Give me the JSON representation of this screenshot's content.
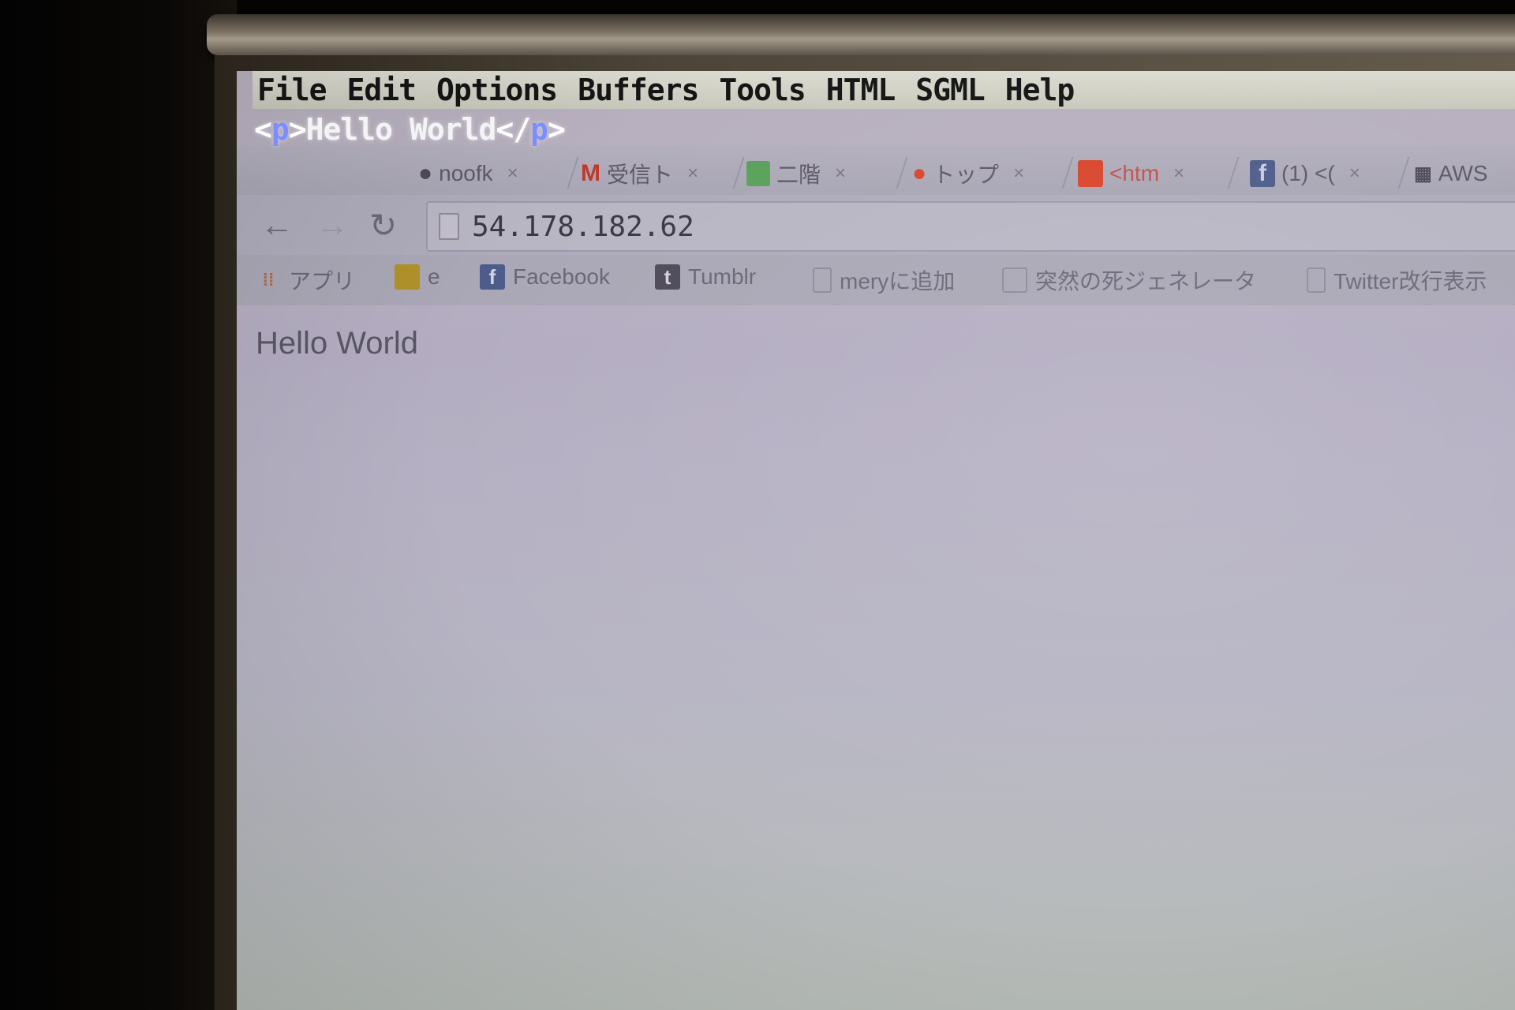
{
  "emacs": {
    "menu": [
      "File",
      "Edit",
      "Options",
      "Buffers",
      "Tools",
      "HTML",
      "SGML",
      "Help"
    ],
    "buffer_line": {
      "open_lt": "<",
      "open_tag": "p",
      "open_gt": ">",
      "text": "Hello World",
      "close_lt": "</",
      "close_tag": "p",
      "close_gt": ">"
    }
  },
  "browser": {
    "tabs": [
      {
        "icon": "github-icon",
        "label": "noofk",
        "close": "×"
      },
      {
        "icon": "gmail-icon",
        "label": "受信ト",
        "close": "×"
      },
      {
        "icon": "sheet-icon",
        "label": "二階",
        "close": "×"
      },
      {
        "icon": "flame-icon",
        "label": "トップ",
        "close": "×"
      },
      {
        "icon": "doc-icon",
        "label": "<htm",
        "close": "×"
      },
      {
        "icon": "facebook-icon",
        "label": "(1) <(",
        "close": "×"
      },
      {
        "icon": "aws-icon",
        "label": "AWS",
        "close": ""
      }
    ],
    "nav": {
      "back": "←",
      "forward": "→",
      "reload": "↻"
    },
    "url": "54.178.182.62",
    "bookmarks": [
      {
        "icon": "apps-grid-icon",
        "label": "アプリ"
      },
      {
        "icon": "evernote-icon",
        "label": "e"
      },
      {
        "icon": "facebook-icon",
        "label": "Facebook"
      },
      {
        "icon": "tumblr-icon",
        "label": "Tumblr"
      },
      {
        "icon": "page-icon",
        "label": "meryに追加"
      },
      {
        "icon": "page-icon",
        "label": "突然の死ジェネレータ"
      },
      {
        "icon": "page-icon",
        "label": "Twitter改行表示"
      }
    ],
    "content_text": "Hello World"
  },
  "colors": {
    "tag": "#7c8dff",
    "screen": "#b4adc2",
    "gmail": "#c0392b",
    "sheet": "#5aa05a",
    "flame": "#d9452b",
    "facebook": "#4d5c8a"
  }
}
